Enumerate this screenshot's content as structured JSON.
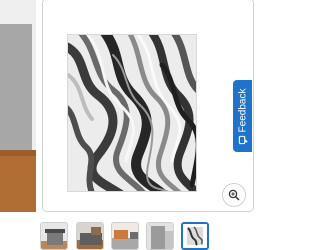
{
  "feedback": {
    "label": "Feedback",
    "icon": "feedback-icon"
  },
  "zoom": {
    "icon": "zoom-in-icon"
  },
  "gallery": {
    "selected_index": 4,
    "thumbnails": [
      {
        "name": "room-scene-1"
      },
      {
        "name": "room-scene-2"
      },
      {
        "name": "room-scene-3"
      },
      {
        "name": "room-scene-4"
      },
      {
        "name": "rug-top-view"
      }
    ]
  },
  "colors": {
    "accent": "#1f73c9",
    "floor": "#b06d34"
  }
}
